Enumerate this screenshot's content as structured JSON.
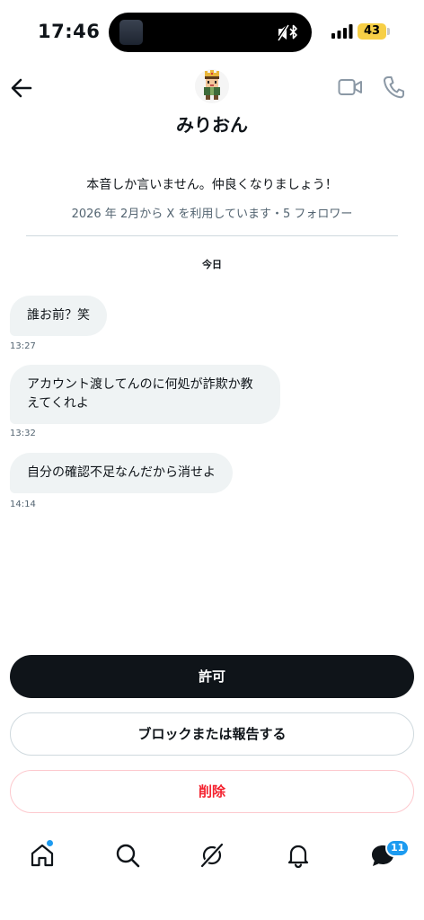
{
  "status_bar": {
    "time": "17:46",
    "battery": "43",
    "sound_icon": "speaker-muted-bluetooth-icon",
    "signal_icon": "cellular-signal-icon"
  },
  "header": {
    "display_name": "みりおん",
    "avatar_icon": "pixel-character-avatar",
    "icons": [
      "back-arrow-icon",
      "video-camera-icon",
      "phone-icon"
    ]
  },
  "profile": {
    "bio": "本音しか言いません。仲良くなりましょう！",
    "meta": "2026 年 2月から X を利用しています・5 フォロワー"
  },
  "conversation": {
    "date_label": "今日",
    "messages": [
      {
        "text": "誰お前？笑",
        "time": "13:27"
      },
      {
        "text": "アカウント渡してんのに何処が詐欺か教えてくれよ",
        "line1": "アカウント渡してんのに何処が詐欺か教",
        "line2": "えてくれよ",
        "time": "13:32"
      },
      {
        "text": "自分の確認不足なんだから消せよ",
        "time": "14:14"
      }
    ]
  },
  "actions": {
    "allow": "許可",
    "block_report": "ブロックまたは報告する",
    "delete": "削除"
  },
  "tab_bar": {
    "items": [
      "home-icon",
      "search-icon",
      "grok-icon",
      "notifications-icon",
      "messages-icon"
    ],
    "messages_badge": "11"
  },
  "colors": {
    "primary": "#0f1419",
    "accent": "#1d9bf0",
    "danger": "#f4212e",
    "bubble": "#eff3f4",
    "muted": "#536471",
    "battery": "#f7cf46"
  }
}
